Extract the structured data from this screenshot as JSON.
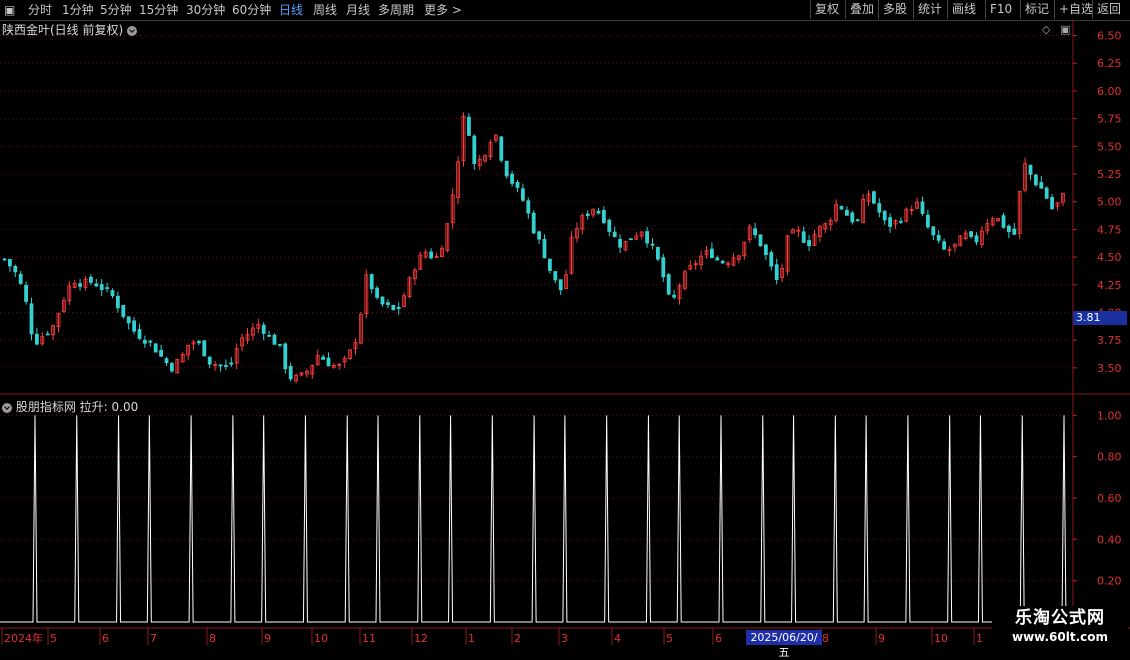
{
  "toolbar": {
    "left_items": [
      "分时",
      "1分钟",
      "5分钟",
      "15分钟",
      "30分钟",
      "60分钟",
      "日线",
      "周线",
      "月线",
      "多周期",
      "更多 >"
    ],
    "active": "日线",
    "right_items": [
      "复权",
      "叠加",
      "多股",
      "统计",
      "画线",
      "F10",
      "标记",
      "+自选",
      "返回"
    ]
  },
  "main_title": "陕西金叶(日线 前复权)",
  "indicator_title": "股朋指标网 拉升: 0.00",
  "price_label": "3.81",
  "selected_date": "2025/06/20/五",
  "logo": {
    "line1": "乐淘公式网",
    "line2": "www.60lt.com"
  },
  "colors": {
    "up": "#ff3d3d",
    "down": "#35d0d0",
    "grid": "#6a1010",
    "signal": "#ffffff",
    "axis_text": "#e03030",
    "date_text": "#e03030"
  },
  "chart_data": [
    {
      "type": "candlestick",
      "ylim": [
        3.3,
        6.55
      ],
      "yticks": [
        "6.50",
        "6.25",
        "6.00",
        "5.75",
        "5.50",
        "5.25",
        "5.00",
        "4.75",
        "4.50",
        "4.25",
        "4.00",
        "3.75",
        "3.50"
      ],
      "x_labels": [
        "2024年",
        "5",
        "6",
        "7",
        "8",
        "9",
        "10",
        "11",
        "12",
        "1",
        "2",
        "3",
        "4",
        "5",
        "6",
        "2025/06/20/五",
        "8",
        "9",
        "10",
        "1"
      ],
      "close_path": [
        4.48,
        4.38,
        4.18,
        3.72,
        3.8,
        3.88,
        4.12,
        4.3,
        4.26,
        4.28,
        4.22,
        4.15,
        4.0,
        3.85,
        3.78,
        3.72,
        3.6,
        3.5,
        3.58,
        3.75,
        3.7,
        3.55,
        3.52,
        3.5,
        3.75,
        3.82,
        3.9,
        3.78,
        3.7,
        3.42,
        3.4,
        3.48,
        3.62,
        3.55,
        3.5,
        3.58,
        3.8,
        4.35,
        4.1,
        4.05,
        4.0,
        4.2,
        4.45,
        4.55,
        4.48,
        4.7,
        5.2,
        5.85,
        5.3,
        5.45,
        5.65,
        5.3,
        5.15,
        5.0,
        4.75,
        4.55,
        4.3,
        4.18,
        4.72,
        4.85,
        4.95,
        4.88,
        4.7,
        4.6,
        4.68,
        4.75,
        4.6,
        4.4,
        4.05,
        4.28,
        4.4,
        4.5,
        4.55,
        4.45,
        4.48,
        4.55,
        4.75,
        4.65,
        4.45,
        4.25,
        4.7,
        4.72,
        4.62,
        4.75,
        4.8,
        5.0,
        4.88,
        4.8,
        5.1,
        4.95,
        4.78,
        4.82,
        4.9,
        5.0,
        4.8,
        4.65,
        4.55,
        4.6,
        4.7,
        4.62,
        4.8,
        4.88,
        4.78,
        4.68,
        5.35,
        5.2,
        5.1,
        4.92,
        5.05
      ]
    },
    {
      "type": "signal_line",
      "name": "拉升",
      "ylim": [
        0,
        1.05
      ],
      "yticks": [
        "1.00",
        "0.80",
        "0.60",
        "0.40",
        "0.20"
      ],
      "current_value": 0.0,
      "signal_count": 28
    }
  ]
}
